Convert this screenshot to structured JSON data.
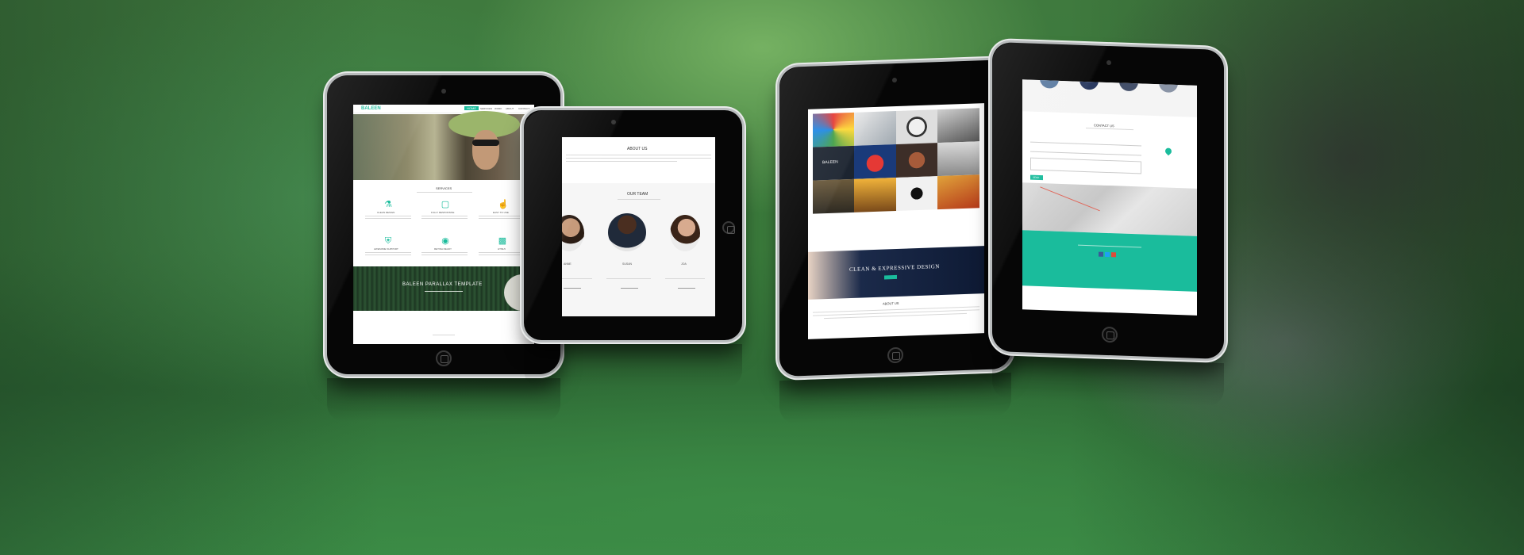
{
  "scene": {
    "description_colors": {
      "background_green": "#3f7a3e",
      "accent_teal": "#1abc9c",
      "device_black": "#060606"
    }
  },
  "tablet1": {
    "logo": "BALEEN",
    "nav": [
      "HOME",
      "SERVICES",
      "WORK",
      "ABOUT",
      "CONTACT"
    ],
    "services_title": "SERVICES",
    "services": [
      {
        "title": "CLEAN DESIGN",
        "icon": "flask-icon"
      },
      {
        "title": "FULLY RESPONSIVE",
        "icon": "monitor-icon"
      },
      {
        "title": "EASY TO USE",
        "icon": "thumbs-up-icon"
      },
      {
        "title": "AWESOME SUPPORT",
        "icon": "shield-icon"
      },
      {
        "title": "RETINA READY",
        "icon": "eye-icon"
      },
      {
        "title": "HTML5",
        "icon": "html5-icon"
      }
    ],
    "banner_title": "BALEEN PARALLAX TEMPLATE"
  },
  "tablet2": {
    "about_title": "ABOUT US",
    "team_title": "OUR TEAM",
    "members": [
      {
        "name": "ANNE"
      },
      {
        "name": "SUSAN"
      },
      {
        "name": "JOA"
      }
    ]
  },
  "tablet3": {
    "brand": "BALEEN",
    "hero_title": "CLEAN & EXPRESSIVE DESIGN",
    "about_title": "ABOUT US"
  },
  "tablet4": {
    "contact_title": "CONTACT US",
    "send_label": "SEND"
  }
}
